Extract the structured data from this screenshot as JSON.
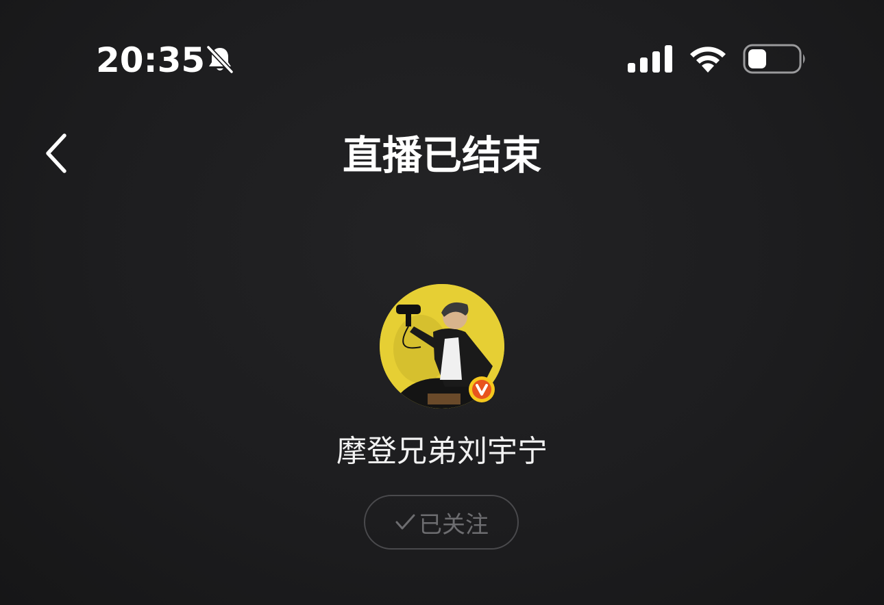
{
  "status_bar": {
    "time": "20:35",
    "icons": [
      "bell-slash-icon",
      "cellular-signal-icon",
      "wifi-icon",
      "battery-icon"
    ]
  },
  "nav": {
    "back_icon": "chevron-left-icon",
    "title": "直播已结束"
  },
  "profile": {
    "avatar_accent": "#e9d23a",
    "verified_badge_color": "#e8541e",
    "name": "摩登兄弟刘宇宁",
    "follow_label": "已关注",
    "follow_icon": "check-icon"
  },
  "colors": {
    "background": "#1c1c1e",
    "text": "#ffffff",
    "muted": "#6d6d70"
  }
}
